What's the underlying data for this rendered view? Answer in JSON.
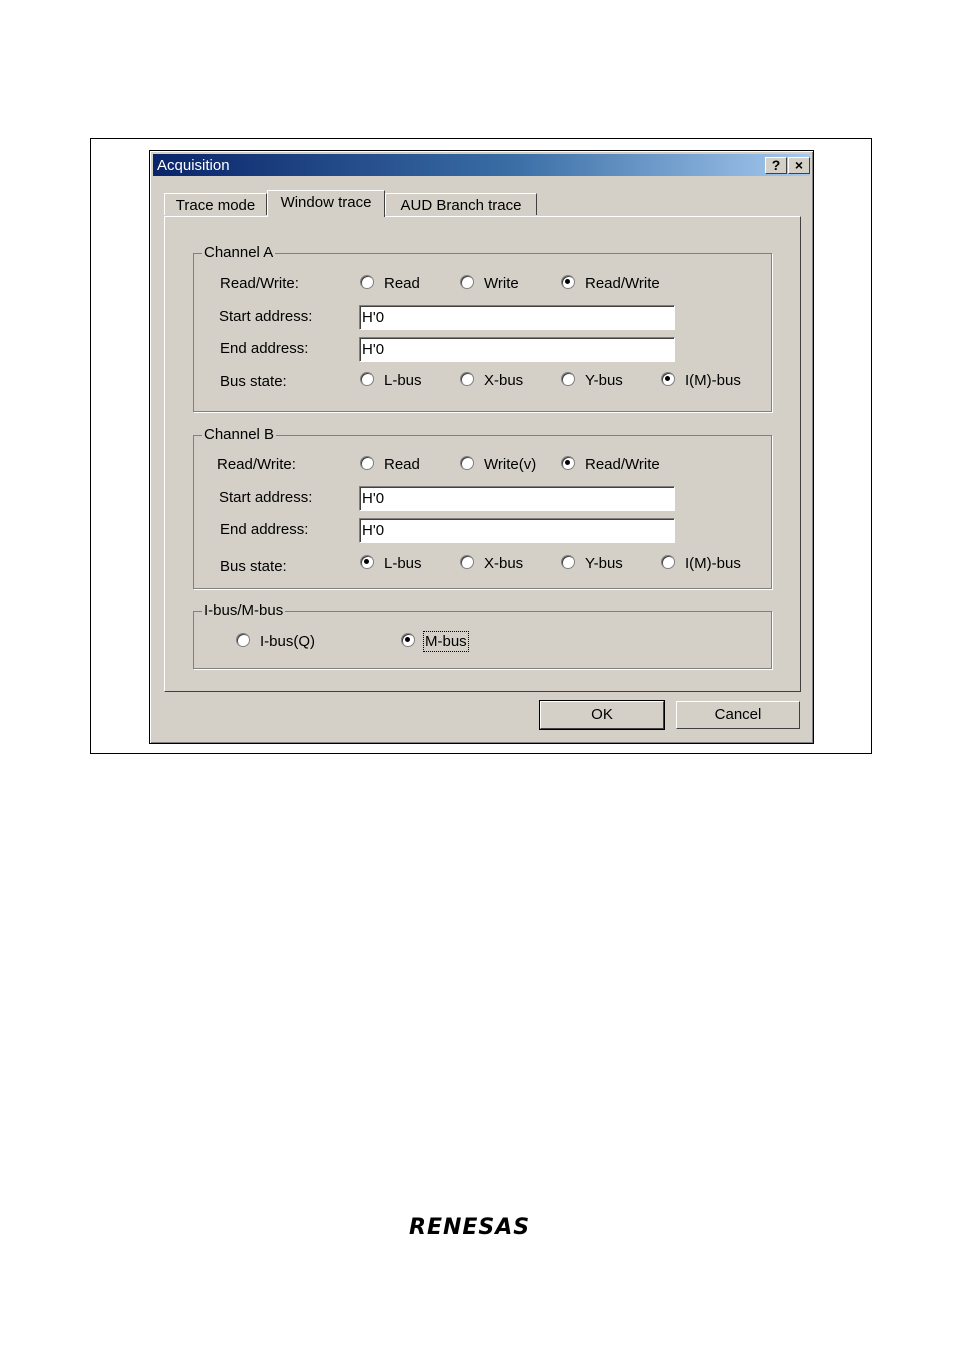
{
  "dialog": {
    "title": "Acquisition",
    "help_button": "?",
    "close_button": "×"
  },
  "tabs": [
    "Trace mode",
    "Window trace",
    "AUD Branch trace"
  ],
  "active_tab": "Window trace",
  "channel_a": {
    "legend": "Channel A",
    "rw_label": "Read/Write:",
    "rw_options": [
      "Read",
      "Write",
      "Read/Write"
    ],
    "rw_selected": "Read/Write",
    "start_label": "Start address:",
    "start_value": "H'0",
    "end_label": "End address:",
    "end_value": "H'0",
    "bus_label": "Bus state:",
    "bus_options": [
      "L-bus",
      "X-bus",
      "Y-bus",
      "I(M)-bus"
    ],
    "bus_selected": "I(M)-bus"
  },
  "channel_b": {
    "legend": "Channel B",
    "rw_label": "Read/Write:",
    "rw_options": [
      "Read",
      "Write(v)",
      "Read/Write"
    ],
    "rw_selected": "Read/Write",
    "start_label": "Start address:",
    "start_value": "H'0",
    "end_label": "End address:",
    "end_value": "H'0",
    "bus_label": "Bus state:",
    "bus_options": [
      "L-bus",
      "X-bus",
      "Y-bus",
      "I(M)-bus"
    ],
    "bus_selected": "L-bus"
  },
  "ibus_mbus": {
    "legend": "I-bus/M-bus",
    "options": [
      "I-bus(Q)",
      "M-bus"
    ],
    "selected": "M-bus"
  },
  "buttons": {
    "ok": "OK",
    "cancel": "Cancel"
  },
  "footer_logo": "RENESAS"
}
